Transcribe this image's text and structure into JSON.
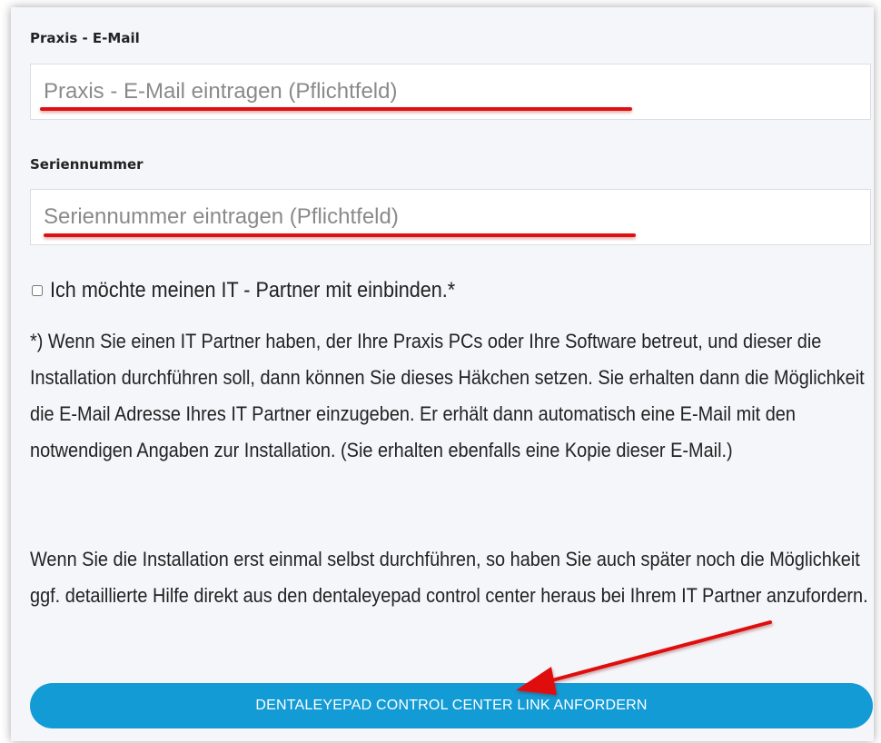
{
  "form": {
    "email": {
      "label": "Praxis - E-Mail",
      "placeholder": "Praxis - E-Mail eintragen (Pflichtfeld)"
    },
    "serial": {
      "label": "Seriennummer",
      "placeholder": "Seriennummer eintragen (Pflichtfeld)"
    },
    "it_partner_checkbox": {
      "label": "Ich möchte meinen IT - Partner mit einbinden.*",
      "checked": false
    },
    "info_paragraph_1": "*) Wenn Sie einen IT Partner haben, der Ihre Praxis PCs oder Ihre Software betreut, und dieser die Installation durchführen soll, dann können Sie dieses Häkchen setzen. Sie erhalten dann die Möglichkeit die E-Mail Adresse Ihres IT Partner einzugeben. Er erhält dann automatisch eine E-Mail mit den notwendigen Angaben zur Installation. (Sie erhalten ebenfalls eine Kopie dieser E-Mail.)",
    "info_paragraph_2": "Wenn Sie die Installation erst einmal selbst durchführen, so haben Sie auch später noch die Möglichkeit ggf. detaillierte Hilfe direkt aus den dentaleyepad control center heraus bei Ihrem IT Partner anzufordern.",
    "submit_label": "DENTALEYEPAD CONTROL CENTER LINK ANFORDERN"
  },
  "colors": {
    "button": "#139bd5",
    "annotation": "#e01010"
  }
}
